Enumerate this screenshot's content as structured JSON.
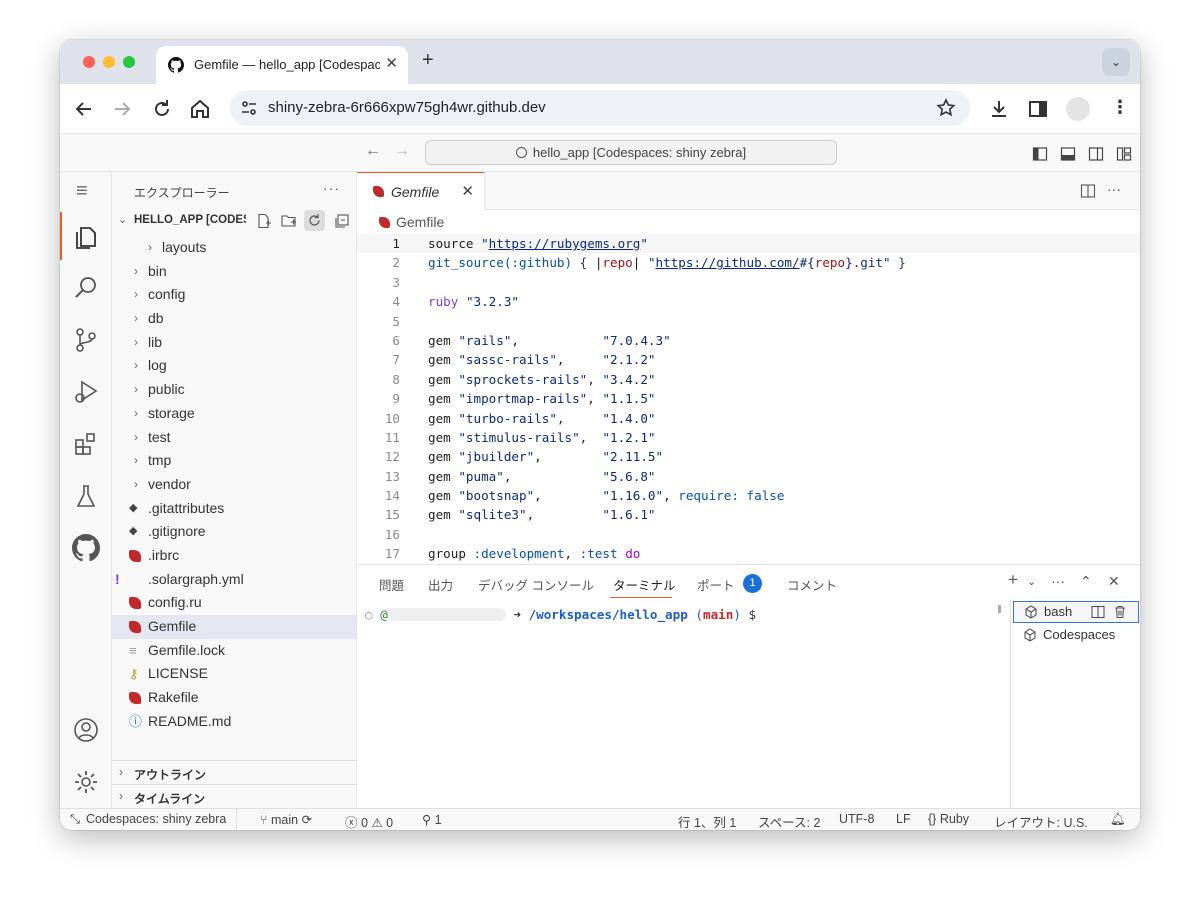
{
  "browser": {
    "tab_title": "Gemfile — hello_app [Codespaces: shiny zebra]",
    "url": "shiny-zebra-6r666xpw75gh4wr.github.dev"
  },
  "vscode": {
    "command_center": "hello_app [Codespaces: shiny zebra]"
  },
  "sidebar": {
    "title": "エクスプローラー",
    "section_title": "HELLO_APP [CODESPACES: SHINY ZEBRA]",
    "items": [
      {
        "label": "layouts",
        "type": "folder",
        "indent": 2
      },
      {
        "label": "bin",
        "type": "folder",
        "indent": 1
      },
      {
        "label": "config",
        "type": "folder",
        "indent": 1
      },
      {
        "label": "db",
        "type": "folder",
        "indent": 1
      },
      {
        "label": "lib",
        "type": "folder",
        "indent": 1
      },
      {
        "label": "log",
        "type": "folder",
        "indent": 1
      },
      {
        "label": "public",
        "type": "folder",
        "indent": 1
      },
      {
        "label": "storage",
        "type": "folder",
        "indent": 1
      },
      {
        "label": "test",
        "type": "folder",
        "indent": 1
      },
      {
        "label": "tmp",
        "type": "folder",
        "indent": 1
      },
      {
        "label": "vendor",
        "type": "folder",
        "indent": 1
      },
      {
        "label": ".gitattributes",
        "type": "git",
        "indent": 1
      },
      {
        "label": ".gitignore",
        "type": "git",
        "indent": 1
      },
      {
        "label": ".irbrc",
        "type": "ruby",
        "indent": 1
      },
      {
        "label": ".solargraph.yml",
        "type": "yaml",
        "indent": 1
      },
      {
        "label": "config.ru",
        "type": "ruby",
        "indent": 1
      },
      {
        "label": "Gemfile",
        "type": "ruby",
        "indent": 1,
        "selected": true
      },
      {
        "label": "Gemfile.lock",
        "type": "text",
        "indent": 1
      },
      {
        "label": "LICENSE",
        "type": "license",
        "indent": 1
      },
      {
        "label": "Rakefile",
        "type": "ruby",
        "indent": 1
      },
      {
        "label": "README.md",
        "type": "info",
        "indent": 1
      }
    ],
    "outline": "アウトライン",
    "timeline": "タイムライン"
  },
  "editor": {
    "tab_label": "Gemfile",
    "breadcrumb": "Gemfile",
    "lines": [
      "1",
      "2",
      "3",
      "4",
      "5",
      "6",
      "7",
      "8",
      "9",
      "10",
      "11",
      "12",
      "13",
      "14",
      "15",
      "16",
      "17"
    ]
  },
  "panel": {
    "tabs": [
      "問題",
      "出力",
      "デバッグ コンソール",
      "ターミナル",
      "ポート",
      "コメント"
    ],
    "ports_badge": "1",
    "prompt_path": "/workspaces/hello_app",
    "prompt_branch": "main",
    "terminals": [
      "bash",
      "Codespaces"
    ]
  },
  "status": {
    "remote": "Codespaces: shiny zebra",
    "branch": "main",
    "errors": "0",
    "warnings": "0",
    "ports": "1",
    "position": "行 1、列 1",
    "spaces": "スペース: 2",
    "encoding": "UTF-8",
    "eol": "LF",
    "language": "Ruby",
    "layout": "レイアウト: U.S."
  },
  "colors": {
    "accent": "#f25c26",
    "ruby": "#c02a2a",
    "badge": "#1b6fd8"
  }
}
